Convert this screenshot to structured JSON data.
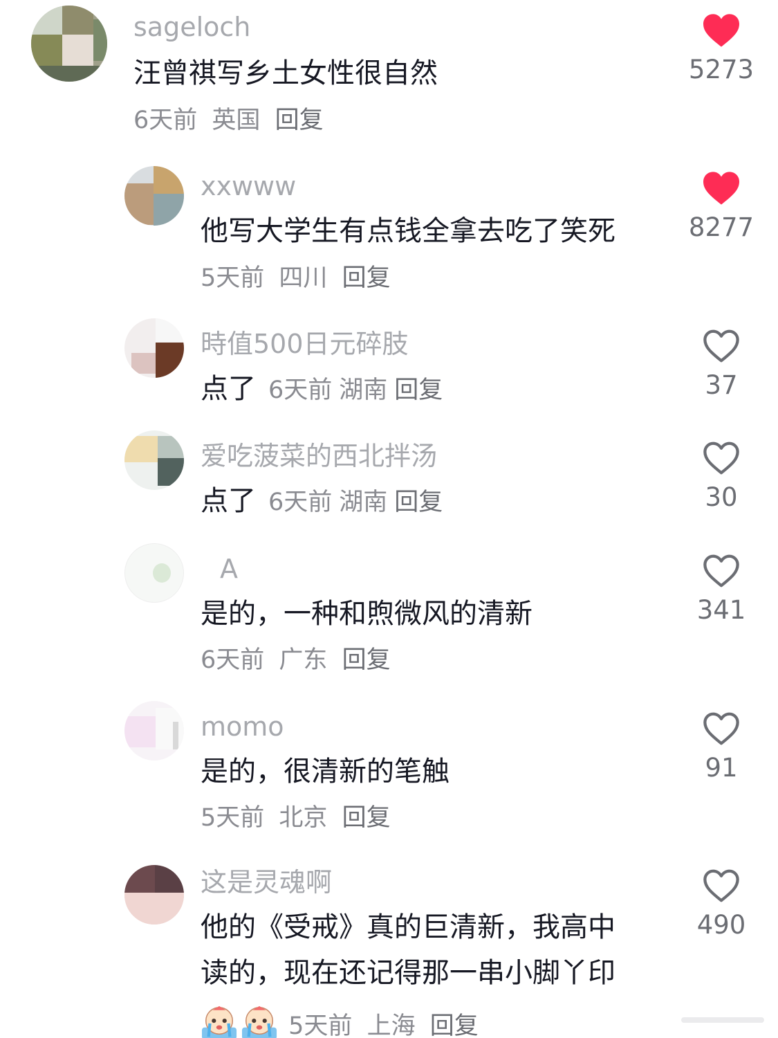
{
  "colors": {
    "like_active": "#fe2c55",
    "username": "#a6a8ad",
    "meta": "#8a8b91",
    "text": "#161823"
  },
  "comments": [
    {
      "username": "sageloch",
      "text": "汪曾祺写乡土女性很自然",
      "time": "6天前",
      "location": "英国",
      "reply": "回复",
      "likes": "5273",
      "liked": true,
      "icon": "heart-filled-icon"
    },
    {
      "username": "xxwww",
      "text": "他写大学生有点钱全拿去吃了笑死",
      "time": "5天前",
      "location": "四川",
      "reply": "回复",
      "likes": "8277",
      "liked": true,
      "icon": "heart-filled-icon"
    },
    {
      "username": "時值500日元碎肢",
      "text": "点了",
      "time": "6天前",
      "location": "湖南",
      "reply": "回复",
      "likes": "37",
      "liked": false,
      "icon": "heart-outline-icon"
    },
    {
      "username": "爱吃菠菜的西北拌汤",
      "text": "点了",
      "time": "6天前",
      "location": "湖南",
      "reply": "回复",
      "likes": "30",
      "liked": false,
      "icon": "heart-outline-icon"
    },
    {
      "username": "A",
      "text": "是的，一种和煦微风的清新",
      "time": "6天前",
      "location": "广东",
      "reply": "回复",
      "likes": "341",
      "liked": false,
      "icon": "heart-outline-icon"
    },
    {
      "username": "momo",
      "text": "是的，很清新的笔触",
      "time": "5天前",
      "location": "北京",
      "reply": "回复",
      "likes": "91",
      "liked": false,
      "icon": "heart-outline-icon"
    },
    {
      "username": "这是灵魂啊",
      "text_line1": "他的《受戒》真的巨清新，我高中",
      "text_line2": "读的，现在还记得那一串小脚丫印",
      "time": "5天前",
      "location": "上海",
      "reply": "回复",
      "likes": "490",
      "liked": false,
      "icon": "heart-outline-icon",
      "emoji": "crying-face-emoji"
    }
  ]
}
